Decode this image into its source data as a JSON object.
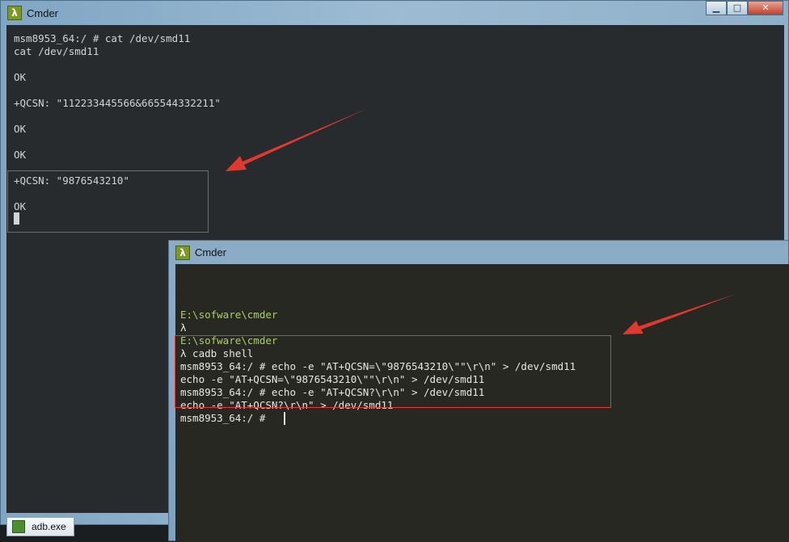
{
  "window1": {
    "title": "Cmder",
    "lines": [
      "msm8953_64:/ # cat /dev/smd11",
      "cat /dev/smd11",
      "",
      "OK",
      "",
      "+QCSN: \"112233445566&665544332211\"",
      "",
      "OK",
      "",
      "OK",
      "",
      "+QCSN: \"9876543210\"",
      "",
      "OK"
    ]
  },
  "taskbar": {
    "label": "adb.exe"
  },
  "window2": {
    "title": "Cmder",
    "lines": [
      {
        "text": "E:\\sofware\\cmder",
        "color": "#a7d35b"
      },
      {
        "text": "λ",
        "color": "#e8e8e3"
      },
      {
        "text": "E:\\sofware\\cmder",
        "color": "#a7d35b"
      },
      {
        "text": "λ cadb shell",
        "color": "#e8e8e3"
      },
      {
        "text": "msm8953_64:/ # echo -e \"AT+QCSN=\\\"9876543210\\\"\"\\r\\n\" > /dev/smd11",
        "color": "#e8e8e3"
      },
      {
        "text": "echo -e \"AT+QCSN=\\\"9876543210\\\"\"\\r\\n\" > /dev/smd11",
        "color": "#e8e8e3"
      },
      {
        "text": "msm8953_64:/ # echo -e \"AT+QCSN?\\r\\n\" > /dev/smd11",
        "color": "#e8e8e3"
      },
      {
        "text": "echo -e \"AT+QCSN?\\r\\n\" > /dev/smd11",
        "color": "#e8e8e3"
      },
      {
        "text": "msm8953_64:/ # ",
        "color": "#e8e8e3"
      }
    ]
  },
  "window_buttons": {
    "minimize": "▁",
    "maximize": "□",
    "close": "✕"
  },
  "colors": {
    "highlight": "#e8393a",
    "arrow": "#e0392f"
  }
}
